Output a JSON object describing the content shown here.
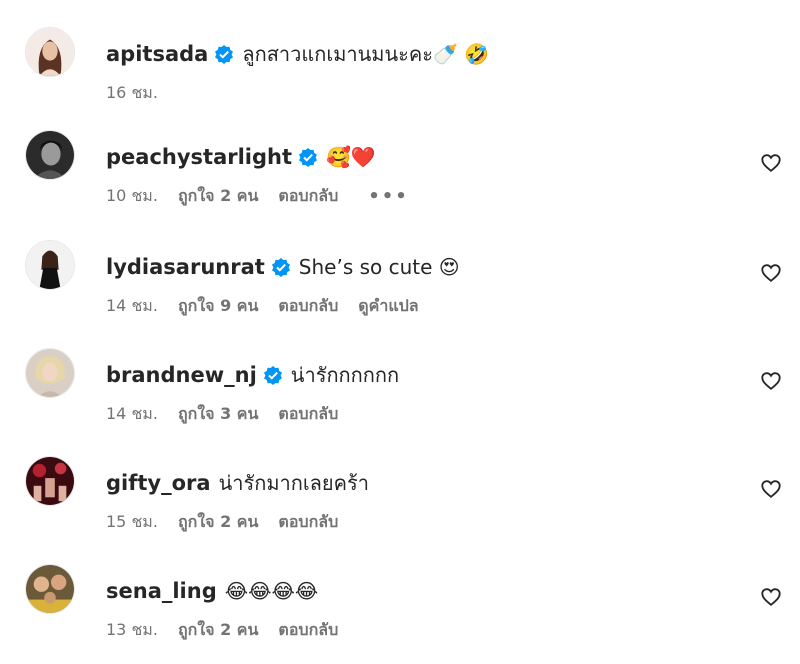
{
  "comments": [
    {
      "username": "apitsada",
      "verified": true,
      "text": "ลูกสาวแกเมานมนะคะ🍼 🤣",
      "time": "16 ชม.",
      "likes": "",
      "reply": "",
      "translate": "",
      "more": false,
      "heart": false
    },
    {
      "username": "peachystarlight",
      "verified": true,
      "text": "🥰❤️",
      "time": "10 ชม.",
      "likes": "ถูกใจ 2 คน",
      "reply": "ตอบกลับ",
      "translate": "",
      "more": true,
      "heart": true
    },
    {
      "username": "lydiasarunrat",
      "verified": true,
      "text": "She’s so cute 😍",
      "time": "14 ชม.",
      "likes": "ถูกใจ 9 คน",
      "reply": "ตอบกลับ",
      "translate": "ดูคำแปล",
      "more": false,
      "heart": true
    },
    {
      "username": "brandnew_nj",
      "verified": true,
      "text": "น่ารักกกกกก",
      "time": "14 ชม.",
      "likes": "ถูกใจ 3 คน",
      "reply": "ตอบกลับ",
      "translate": "",
      "more": false,
      "heart": true
    },
    {
      "username": "gifty_ora",
      "verified": false,
      "text": "น่ารักมากเลยคร้า",
      "time": "15 ชม.",
      "likes": "ถูกใจ 2 คน",
      "reply": "ตอบกลับ",
      "translate": "",
      "more": false,
      "heart": true
    },
    {
      "username": "sena_ling",
      "verified": false,
      "text": "😂😂😂😂",
      "time": "13 ชม.",
      "likes": "ถูกใจ 2 คน",
      "reply": "ตอบกลับ",
      "translate": "",
      "more": false,
      "heart": true
    }
  ],
  "icons": {
    "verified": "verified-badge-icon",
    "heart": "heart-outline-icon",
    "more": "more-options-icon"
  },
  "colors": {
    "verified": "#0095f6",
    "meta": "#737373",
    "text": "#262626"
  }
}
